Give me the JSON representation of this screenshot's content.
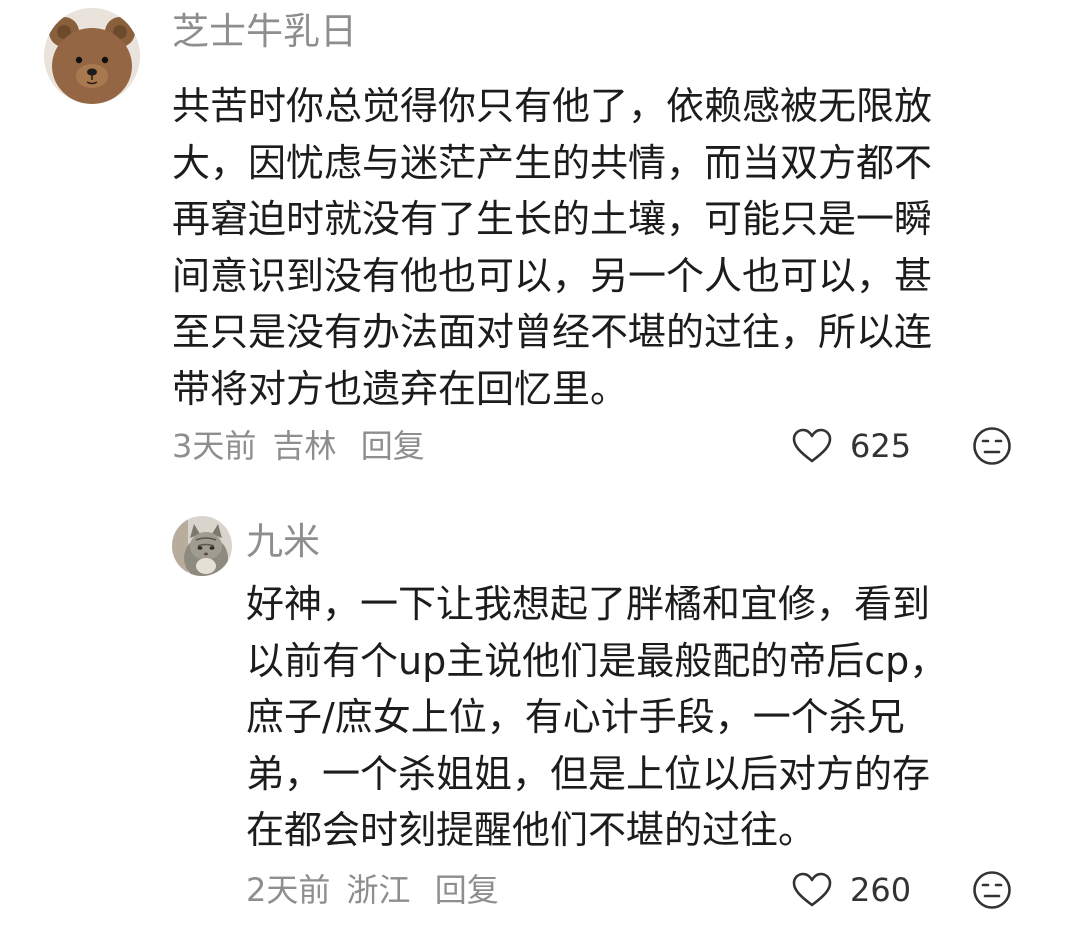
{
  "comments": [
    {
      "username": "芝士牛乳日",
      "avatar_icon": "teddy-bear-avatar",
      "lines": [
        "共苦时你总觉得你只有他了，依赖感被无限放",
        "大，因忧虑与迷茫产生的共情，而当双方都不",
        "再窘迫时就没有了生长的土壤，可能只是一瞬",
        "间意识到没有他也可以，另一个人也可以，甚",
        "至只是没有办法面对曾经不堪的过往，所以连",
        "带将对方也遗弃在回忆里。"
      ],
      "time": "3天前",
      "location": "吉林",
      "reply_label": "回复",
      "like_icon": "heart-icon",
      "likes": "625",
      "dislike_icon": "unhappy-face-icon"
    },
    {
      "username": "九米",
      "avatar_icon": "cat-avatar",
      "lines": [
        "好神，一下让我想起了胖橘和宜修，看到",
        "以前有个up主说他们是最般配的帝后cp，",
        "庶子/庶女上位，有心计手段，一个杀兄",
        "弟，一个杀姐姐，但是上位以后对方的存",
        "在都会时刻提醒他们不堪的过往。"
      ],
      "time": "2天前",
      "location": "浙江",
      "reply_label": "回复",
      "like_icon": "heart-icon",
      "likes": "260",
      "dislike_icon": "unhappy-face-icon"
    }
  ]
}
